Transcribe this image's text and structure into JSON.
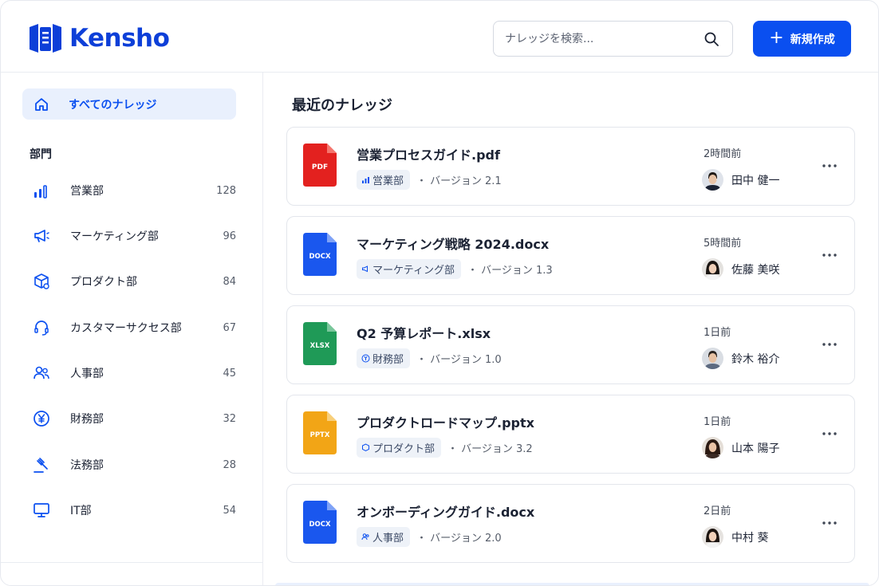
{
  "app": {
    "name": "Kensho"
  },
  "header": {
    "search_placeholder": "ナレッジを検索...",
    "new_button_label": "新規作成",
    "new_button_icon": "plus-icon",
    "accent_color": "#0a4ff0"
  },
  "sidebar": {
    "all_label": "すべてのナレッジ",
    "all_icon": "home-icon",
    "section_title": "部門",
    "departments": [
      {
        "label": "営業部",
        "count": "128",
        "icon": "bar-chart-icon"
      },
      {
        "label": "マーケティング部",
        "count": "96",
        "icon": "megaphone-icon"
      },
      {
        "label": "プロダクト部",
        "count": "84",
        "icon": "box-icon"
      },
      {
        "label": "カスタマーサクセス部",
        "count": "67",
        "icon": "headset-icon"
      },
      {
        "label": "人事部",
        "count": "45",
        "icon": "users-icon"
      },
      {
        "label": "財務部",
        "count": "32",
        "icon": "yen-icon"
      },
      {
        "label": "法務部",
        "count": "28",
        "icon": "gavel-icon"
      },
      {
        "label": "IT部",
        "count": "54",
        "icon": "monitor-icon"
      }
    ]
  },
  "main": {
    "title": "最近のナレッジ",
    "items": [
      {
        "name": "営業プロセスガイド.pdf",
        "file_type": "PDF",
        "file_color": "#e3211f",
        "dept": "営業部",
        "dept_icon": "bar-chart-icon",
        "version": "・ バージョン 2.1",
        "time": "2時間前",
        "author": "田中 健一"
      },
      {
        "name": "マーケティング戦略 2024.docx",
        "file_type": "DOCX",
        "file_color": "#1a57ee",
        "dept": "マーケティング部",
        "dept_icon": "megaphone-icon",
        "version": "・ バージョン 1.3",
        "time": "5時間前",
        "author": "佐藤 美咲"
      },
      {
        "name": "Q2 予算レポート.xlsx",
        "file_type": "XLSX",
        "file_color": "#1f9a57",
        "dept": "財務部",
        "dept_icon": "yen-icon",
        "version": "・ バージョン 1.0",
        "time": "1日前",
        "author": "鈴木 裕介"
      },
      {
        "name": "プロダクトロードマップ.pptx",
        "file_type": "PPTX",
        "file_color": "#f2a516",
        "dept": "プロダクト部",
        "dept_icon": "box-icon",
        "version": "・ バージョン 3.2",
        "time": "1日前",
        "author": "山本 陽子"
      },
      {
        "name": "オンボーディングガイド.docx",
        "file_type": "DOCX",
        "file_color": "#1a57ee",
        "dept": "人事部",
        "dept_icon": "users-icon",
        "version": "・ バージョン 2.0",
        "time": "2日前",
        "author": "中村 葵"
      }
    ]
  }
}
